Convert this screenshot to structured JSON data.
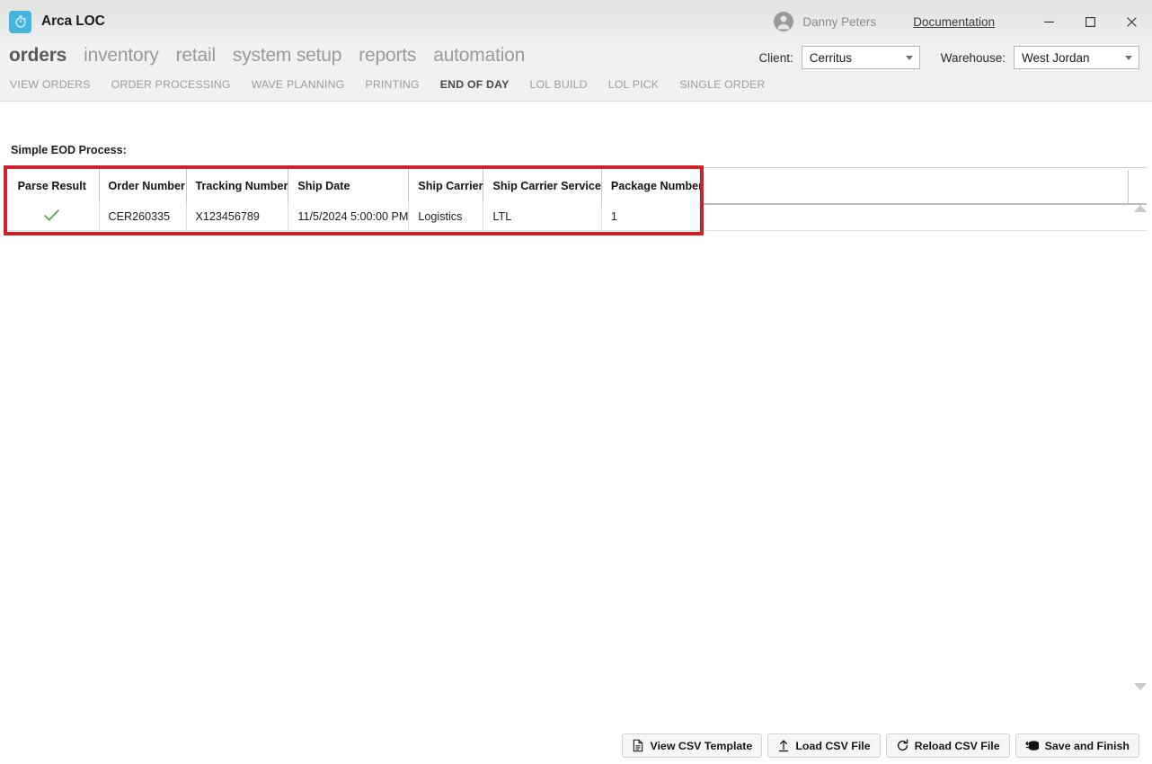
{
  "titlebar": {
    "app_name": "Arca LOC",
    "logo_icon": "stopwatch-icon",
    "logo_color": "#44b5e0",
    "user_name": "Danny Peters",
    "avatar_icon": "user-avatar-icon",
    "documentation_label": "Documentation",
    "minimize_icon": "minimize-icon",
    "maximize_icon": "maximize-icon",
    "close_icon": "close-icon"
  },
  "mainnav": {
    "items": [
      {
        "label": "orders",
        "active": true
      },
      {
        "label": "inventory",
        "active": false
      },
      {
        "label": "retail",
        "active": false
      },
      {
        "label": "system setup",
        "active": false
      },
      {
        "label": "reports",
        "active": false
      },
      {
        "label": "automation",
        "active": false
      }
    ]
  },
  "subnav": {
    "items": [
      {
        "label": "VIEW ORDERS",
        "active": false
      },
      {
        "label": "ORDER PROCESSING",
        "active": false
      },
      {
        "label": "WAVE PLANNING",
        "active": false
      },
      {
        "label": "PRINTING",
        "active": false
      },
      {
        "label": "END OF DAY",
        "active": true
      },
      {
        "label": "LOL BUILD",
        "active": false
      },
      {
        "label": "LOL PICK",
        "active": false
      },
      {
        "label": "SINGLE ORDER",
        "active": false
      }
    ]
  },
  "selectors": {
    "client": {
      "label": "Client:",
      "value": "Cerritus"
    },
    "warehouse": {
      "label": "Warehouse:",
      "value": "West Jordan"
    }
  },
  "main": {
    "section_label": "Simple EOD Process:",
    "table": {
      "columns": [
        "Parse Result",
        "Order Number",
        "Tracking Number",
        "Ship Date",
        "Ship Carrier",
        "Ship Carrier Service",
        "Package Number"
      ],
      "rows": [
        {
          "parse_result": "✓",
          "parse_result_icon": "check-mark-icon",
          "order_number": "CER260335",
          "tracking_number": "X123456789",
          "ship_date": "11/5/2024 5:00:00 PM",
          "ship_carrier": "Logistics",
          "ship_carrier_service": "LTL",
          "package_number": "1"
        }
      ]
    },
    "highlight_color": "#cc2229",
    "check_color": "#4ea64e"
  },
  "scrollbar": {
    "up_arrow_icon": "scroll-up-arrow-icon",
    "down_arrow_icon": "scroll-down-arrow-icon"
  },
  "footer": {
    "buttons": [
      {
        "label": "View CSV Template",
        "icon": "document-icon"
      },
      {
        "label": "Load CSV File",
        "icon": "upload-icon"
      },
      {
        "label": "Reload CSV File",
        "icon": "refresh-icon"
      },
      {
        "label": "Save and Finish",
        "icon": "database-save-icon"
      }
    ]
  }
}
